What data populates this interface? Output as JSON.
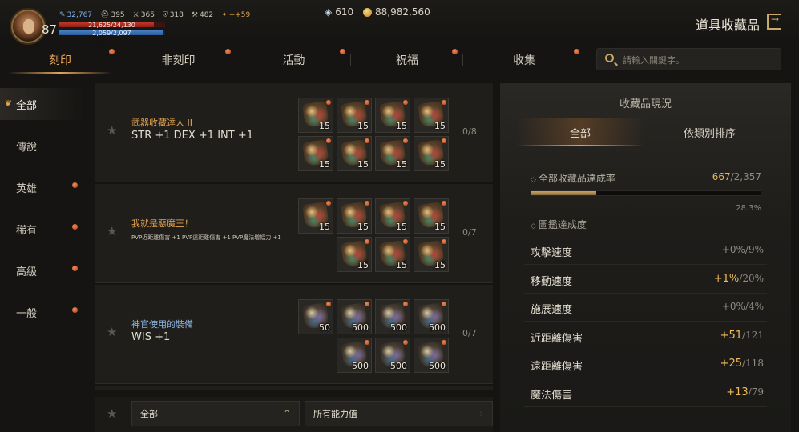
{
  "player": {
    "level": "87",
    "stats": [
      {
        "icon": "feather-icon",
        "glyph": "✎",
        "value": "32,767",
        "color": "blue"
      },
      {
        "icon": "helmet-icon",
        "glyph": "⛑",
        "value": "395",
        "color": "normal"
      },
      {
        "icon": "sword-icon",
        "glyph": "⚔",
        "value": "365",
        "color": "normal"
      },
      {
        "icon": "shield-icon",
        "glyph": "⛨",
        "value": "318",
        "color": "normal"
      },
      {
        "icon": "blade-icon",
        "glyph": "⚒",
        "value": "482",
        "color": "normal"
      },
      {
        "icon": "buff-icon",
        "glyph": "✦",
        "value": "++59",
        "color": "gold"
      }
    ],
    "hp": {
      "text": "21,625/24,130",
      "ratio": 0.896
    },
    "mp": {
      "text": "2,059/2,097",
      "ratio": 0.982
    }
  },
  "currency": {
    "diamond": "610",
    "adena": "88,982,560"
  },
  "header": {
    "title": "道具收藏品"
  },
  "tabs": [
    {
      "label": "刻印",
      "active": true,
      "dot": true
    },
    {
      "label": "非刻印",
      "active": false,
      "dot": true
    },
    {
      "label": "活動",
      "active": false,
      "dot": true
    },
    {
      "label": "祝福",
      "active": false,
      "dot": true
    },
    {
      "label": "收集",
      "active": false,
      "dot": true
    }
  ],
  "search": {
    "placeholder": "請輸入關鍵字。",
    "value": ""
  },
  "sidebar": {
    "items": [
      {
        "label": "全部",
        "active": true,
        "dot": false
      },
      {
        "label": "傳說",
        "active": false,
        "dot": false
      },
      {
        "label": "英雄",
        "active": false,
        "dot": true
      },
      {
        "label": "稀有",
        "active": false,
        "dot": true
      },
      {
        "label": "高級",
        "active": false,
        "dot": true
      },
      {
        "label": "一般",
        "active": false,
        "dot": true
      }
    ]
  },
  "collections": [
    {
      "title": "武器收藏達人 II",
      "title_color": "gold",
      "stat": "STR +1 DEX +1 INT +1",
      "progress": "0/8",
      "items": [
        "15",
        "15",
        "15",
        "15",
        "15",
        "15",
        "15",
        "15"
      ]
    },
    {
      "title": "我就是惡魔王！",
      "title_color": "gold",
      "stat": "PVP近距離傷害 +1  PVP遠距離傷害 +1  PVP魔法增幅力 +1",
      "progress": "0/7",
      "items": [
        "15",
        "15",
        "15",
        "15",
        "15",
        "15",
        "15"
      ]
    },
    {
      "title": "神官使用的裝備",
      "title_color": "blue",
      "stat": "WIS +1",
      "progress": "0/7",
      "items": [
        "50",
        "500",
        "500",
        "500",
        "500",
        "500",
        "500"
      ]
    }
  ],
  "filters": {
    "grade": "全部",
    "ability": "所有能力值"
  },
  "status_panel": {
    "title": "收藏品現況",
    "tabs": [
      {
        "label": "全部",
        "active": true
      },
      {
        "label": "依類別排序",
        "active": false
      }
    ],
    "completion_label": "全部收藏品達成率",
    "completion_current": "667",
    "completion_total": "/2,357",
    "completion_percent": "28.3%",
    "completion_ratio": 0.283,
    "codex_label": "圖鑑達成度",
    "stats": [
      {
        "name": "攻擊速度",
        "current": "+0%",
        "max": "/9%",
        "highlight": false
      },
      {
        "name": "移動速度",
        "current": "+1%",
        "max": "/20%",
        "highlight": true
      },
      {
        "name": "施展速度",
        "current": "+0%",
        "max": "/4%",
        "highlight": false
      },
      {
        "name": "近距離傷害",
        "current": "+51",
        "max": "/121",
        "highlight": true
      },
      {
        "name": "遠距離傷害",
        "current": "+25",
        "max": "/118",
        "highlight": true
      },
      {
        "name": "魔法傷害",
        "current": "+13",
        "max": "/79",
        "highlight": true
      }
    ]
  }
}
